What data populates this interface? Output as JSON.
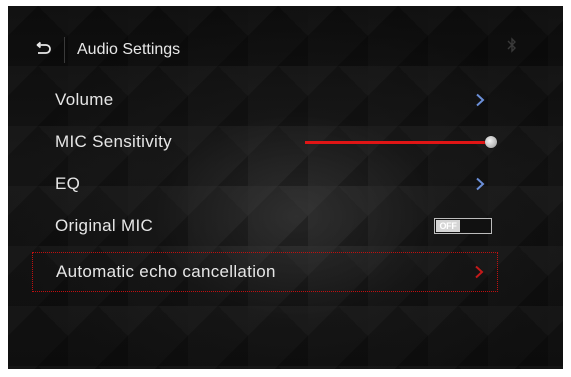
{
  "header": {
    "title": "Audio Settings",
    "back_icon": "back-arrow-icon",
    "status_icon": "bluetooth-icon"
  },
  "menu": {
    "items": [
      {
        "label": "Volume",
        "control": "chevron"
      },
      {
        "label": "MIC Sensitivity",
        "control": "slider",
        "level": 1.0
      },
      {
        "label": "EQ",
        "control": "chevron"
      },
      {
        "label": "Original MIC",
        "control": "toggle",
        "toggle_text": "OFF"
      },
      {
        "label": "Automatic echo cancellation",
        "control": "chevron",
        "selected": true
      }
    ]
  },
  "colors": {
    "accent": "#e01515",
    "chevron": "#6b8fd8",
    "chevron_selected": "#c41a1a",
    "text": "#e6e6e6"
  }
}
